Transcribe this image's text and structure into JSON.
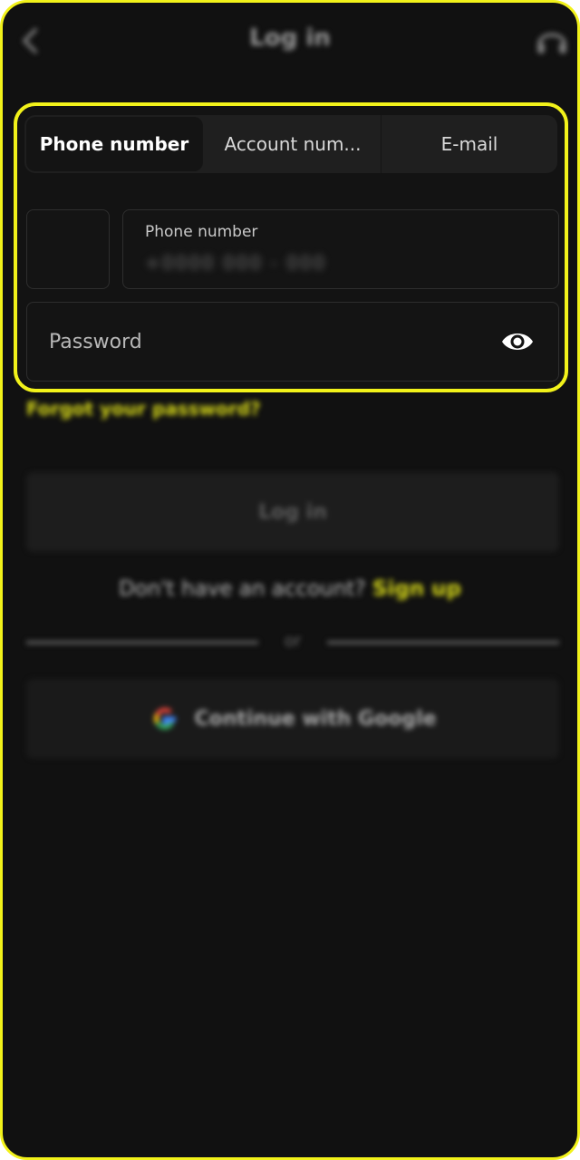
{
  "header": {
    "title": "Log in",
    "back_icon": "chevron-left-icon",
    "support_icon": "headset-icon"
  },
  "tabs": [
    {
      "label": "Phone number",
      "active": true
    },
    {
      "label": "Account num...",
      "active": false
    },
    {
      "label": "E-mail",
      "active": false
    }
  ],
  "phone": {
    "label": "Phone number",
    "value": "+0000 000 - 000"
  },
  "password": {
    "placeholder": "Password",
    "visibility_icon": "eye-icon"
  },
  "links": {
    "forgot": "Forgot your password?"
  },
  "login_button": "Log in",
  "signup": {
    "question": "Don't have an account?",
    "link": "Sign up"
  },
  "divider": "or",
  "google_button": "Continue with Google",
  "colors": {
    "background": "#111111",
    "highlight": "#f2f21a",
    "accent": "#d7d91a"
  }
}
